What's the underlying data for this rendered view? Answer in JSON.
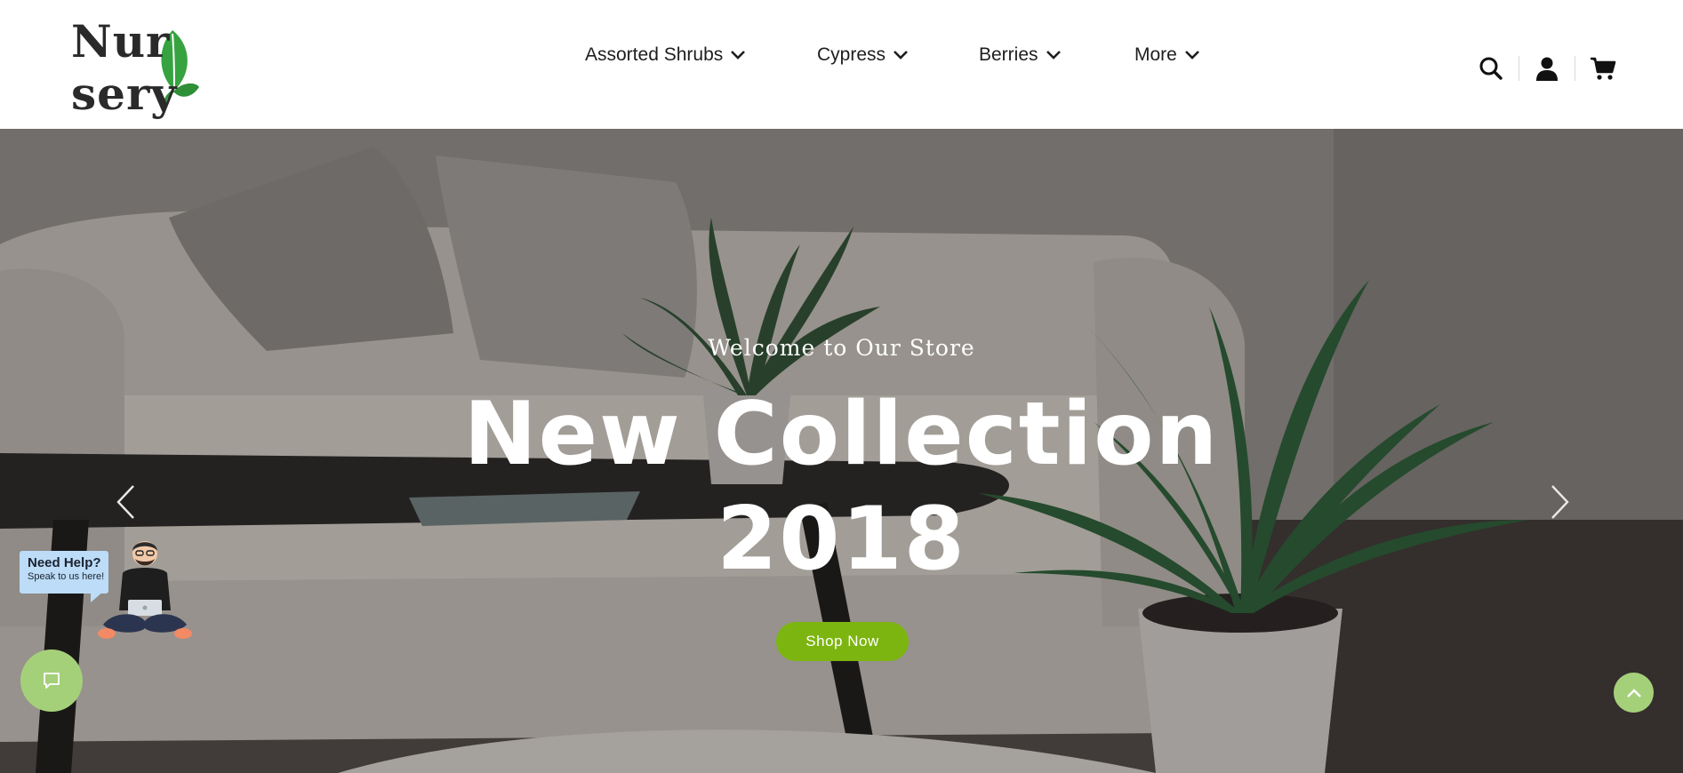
{
  "brand": {
    "logo_text_left": "Nur",
    "logo_text_right": "sery",
    "leaf_color": "#2e9a3a"
  },
  "nav": {
    "items": [
      {
        "label": "Assorted Shrubs",
        "icon": "chevron-down-icon"
      },
      {
        "label": "Cypress",
        "icon": "chevron-down-icon"
      },
      {
        "label": "Berries",
        "icon": "chevron-down-icon"
      },
      {
        "label": "More",
        "icon": "chevron-down-icon"
      }
    ]
  },
  "header_icons": [
    "search-icon",
    "user-icon",
    "cart-icon"
  ],
  "hero": {
    "eyebrow": "Welcome to Our Store",
    "headline_line1": "New Collection",
    "headline_line2": "2018",
    "cta_label": "Shop Now",
    "cta_color": "#7cb50f",
    "prev_icon": "chevron-left-icon",
    "next_icon": "chevron-right-icon"
  },
  "help_widget": {
    "title": "Need Help?",
    "subtitle": "Speak to us here!",
    "chat_icon": "chat-bubble-icon",
    "accent_color": "#a5d07a"
  },
  "scroll_top": {
    "icon": "chevron-up-icon"
  }
}
